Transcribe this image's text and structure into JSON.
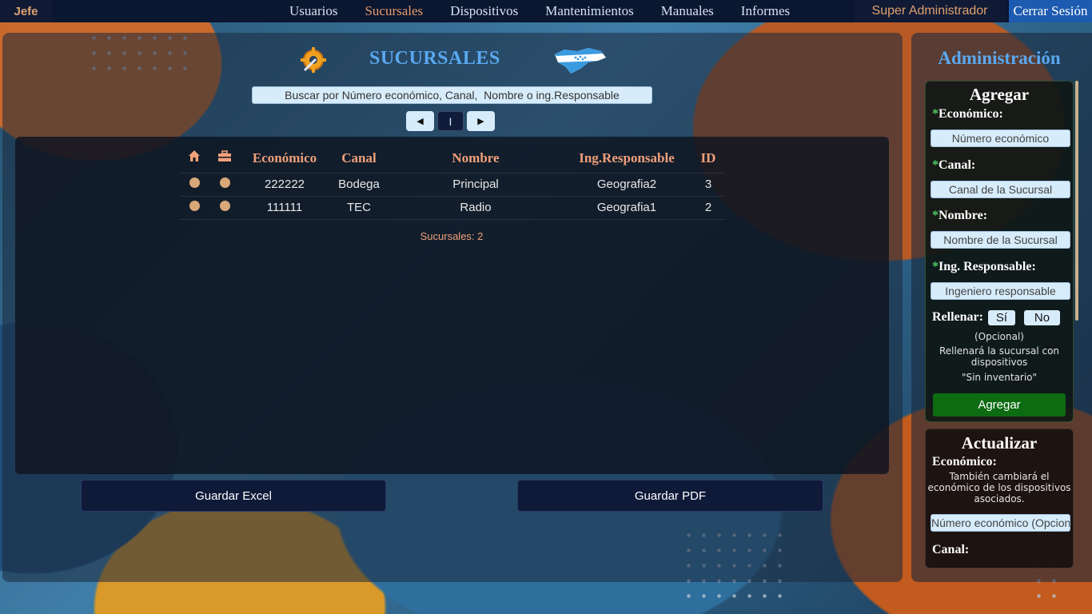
{
  "brand": "Jefe",
  "nav": {
    "items": [
      {
        "label": "Usuarios",
        "active": false
      },
      {
        "label": "Sucursales",
        "active": true
      },
      {
        "label": "Dispositivos",
        "active": false
      },
      {
        "label": "Mantenimientos",
        "active": false
      },
      {
        "label": "Manuales",
        "active": false
      },
      {
        "label": "Informes",
        "active": false
      }
    ],
    "user_role": "Super Administrador",
    "logout_label": "Cerrar Sesión"
  },
  "main": {
    "title": "SUCURSALES",
    "search_placeholder": "Buscar por Número económico, Canal,  Nombre o ing.Responsable",
    "pager": {
      "prev": "◀",
      "current": "I",
      "next": "▶"
    },
    "table": {
      "headers": [
        "",
        "",
        "Económico",
        "Canal",
        "Nombre",
        "Ing.Responsable",
        "ID"
      ],
      "header_icons": [
        "house-icon",
        "toolbox-icon"
      ],
      "rows": [
        {
          "economico": "222222",
          "canal": "Bodega",
          "nombre": "Principal",
          "responsable": "Geografia2",
          "id": "3"
        },
        {
          "economico": "111111",
          "canal": "TEC",
          "nombre": "Radio",
          "responsable": "Geografia1",
          "id": "2"
        }
      ]
    },
    "count_label": "Sucursales: 2",
    "excel_button": "Guardar Excel",
    "pdf_button": "Guardar PDF"
  },
  "sidebar": {
    "title": "Administración",
    "add": {
      "heading": "Agregar",
      "required_mark": "*",
      "economico_label": "Económico:",
      "economico_placeholder": "Número económico",
      "canal_label": "Canal:",
      "canal_placeholder": "Canal de la Sucursal",
      "nombre_label": "Nombre:",
      "nombre_placeholder": "Nombre de la Sucursal",
      "responsable_label": "Ing. Responsable:",
      "responsable_placeholder": "Ingeniero responsable",
      "rellenar_label": "Rellenar:",
      "yes_label": "Sí",
      "no_label": "No",
      "optional_note": "(Opcional)",
      "fill_note": "Rellenará la sucursal con dispositivos",
      "fill_quote": "\"Sin inventario\"",
      "submit_label": "Agregar"
    },
    "update": {
      "heading": "Actualizar",
      "economico_label": "Económico:",
      "economico_note": "También cambiará el económico de los dispositivos asociados.",
      "economico_placeholder": "Número económico (Opcional)",
      "canal_label": "Canal:"
    }
  },
  "colors": {
    "accent": "#5aa8f0",
    "header_text": "#f0a07a",
    "add_button": "#0d6b12"
  }
}
